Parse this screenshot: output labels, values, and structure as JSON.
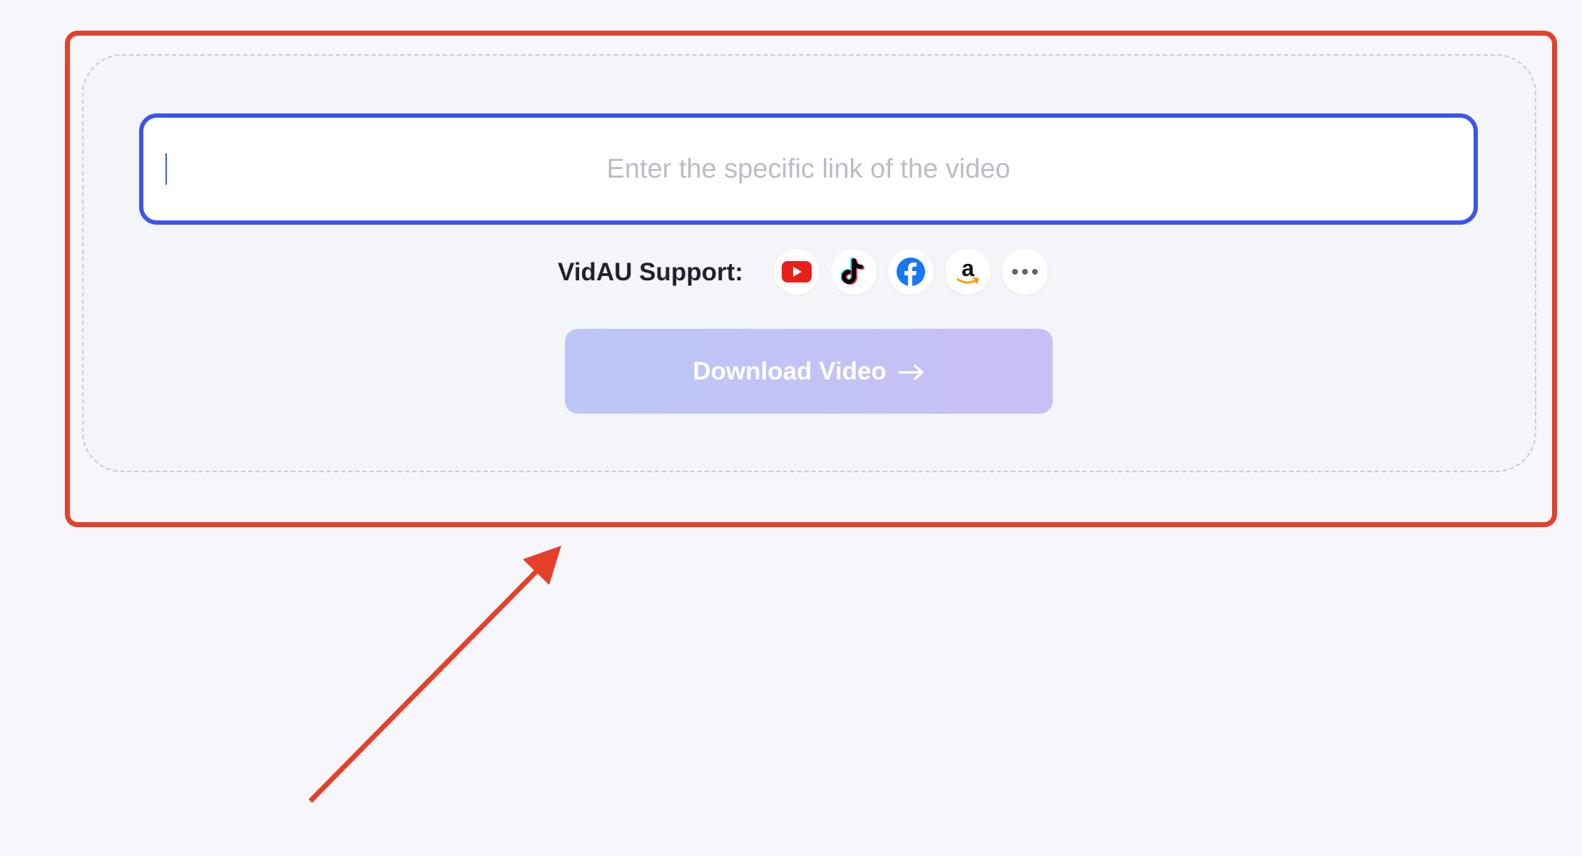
{
  "url_form": {
    "input_placeholder": "Enter the specific link of the video",
    "input_value": ""
  },
  "support": {
    "label": "VidAU Support:",
    "platforms": [
      {
        "name": "YouTube",
        "icon": "youtube-icon"
      },
      {
        "name": "TikTok",
        "icon": "tiktok-icon"
      },
      {
        "name": "Facebook",
        "icon": "facebook-icon"
      },
      {
        "name": "Amazon",
        "icon": "amazon-icon"
      },
      {
        "name": "More",
        "icon": "more-icon"
      }
    ]
  },
  "download_button": {
    "label": "Download Video",
    "icon": "arrow-right-icon"
  },
  "colors": {
    "annotation_red": "#e5402a",
    "input_border_blue": "#3b55eb",
    "button_gradient_start": "#bcc6f7",
    "button_gradient_end": "#c8bff4",
    "background": "#f7f7fb"
  }
}
